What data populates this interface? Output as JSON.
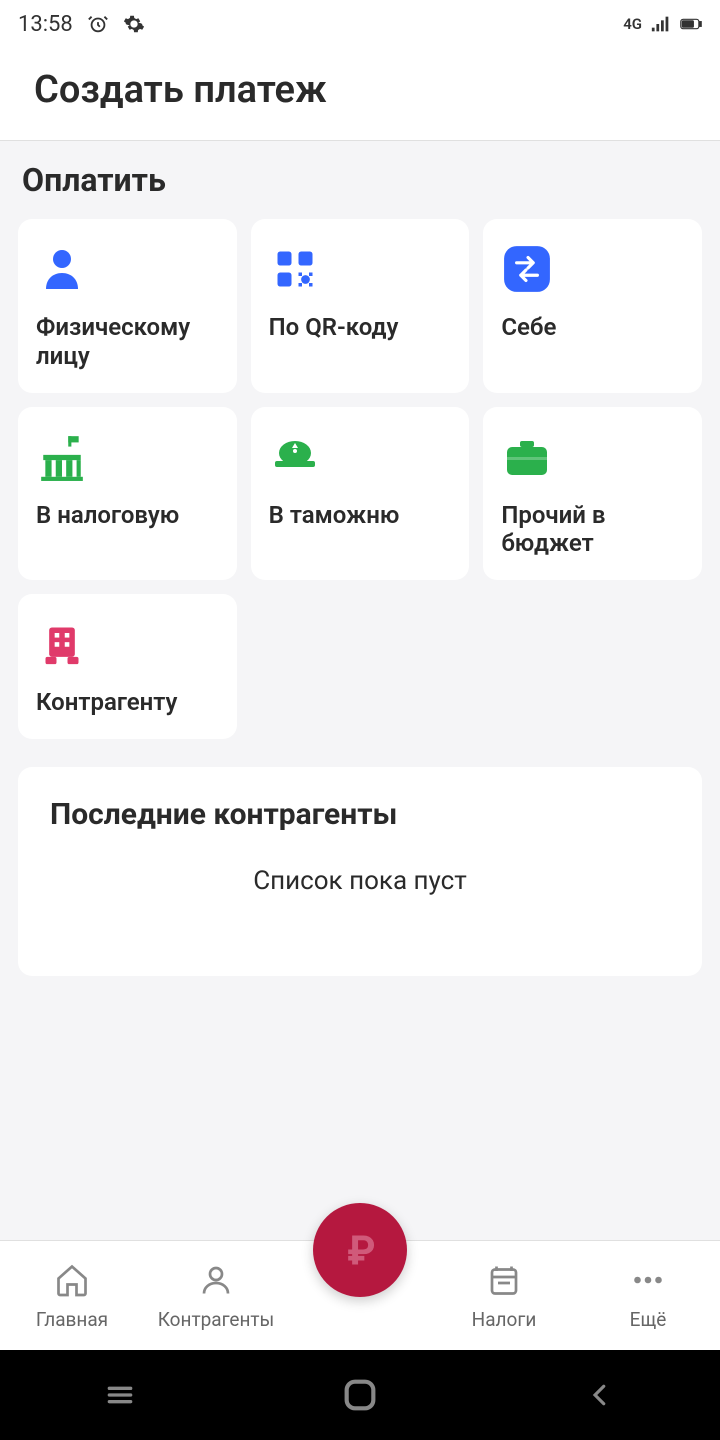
{
  "status_bar": {
    "time": "13:58",
    "network": "4G"
  },
  "header": {
    "title": "Создать платеж"
  },
  "section": {
    "pay_title": "Оплатить"
  },
  "cards": {
    "0": {
      "label": "Физическому лицу",
      "icon": "person-icon"
    },
    "1": {
      "label": "По QR-коду",
      "icon": "qr-icon"
    },
    "2": {
      "label": "Себе",
      "icon": "transfer-icon"
    },
    "3": {
      "label": "В налоговую",
      "icon": "government-icon"
    },
    "4": {
      "label": "В таможню",
      "icon": "customs-icon"
    },
    "5": {
      "label": "Прочий в бюджет",
      "icon": "briefcase-icon"
    },
    "6": {
      "label": "Контрагенту",
      "icon": "building-icon"
    }
  },
  "recent": {
    "title": "Последние контрагенты",
    "empty": "Список пока пуст"
  },
  "nav": {
    "0": {
      "label": "Главная"
    },
    "1": {
      "label": "Контрагенты"
    },
    "2": {
      "label": "Налоги"
    },
    "3": {
      "label": "Ещё"
    }
  },
  "colors": {
    "blue": "#3366ff",
    "green": "#2bb04c",
    "pink": "#e03a6a",
    "fab": "#b5183f"
  }
}
